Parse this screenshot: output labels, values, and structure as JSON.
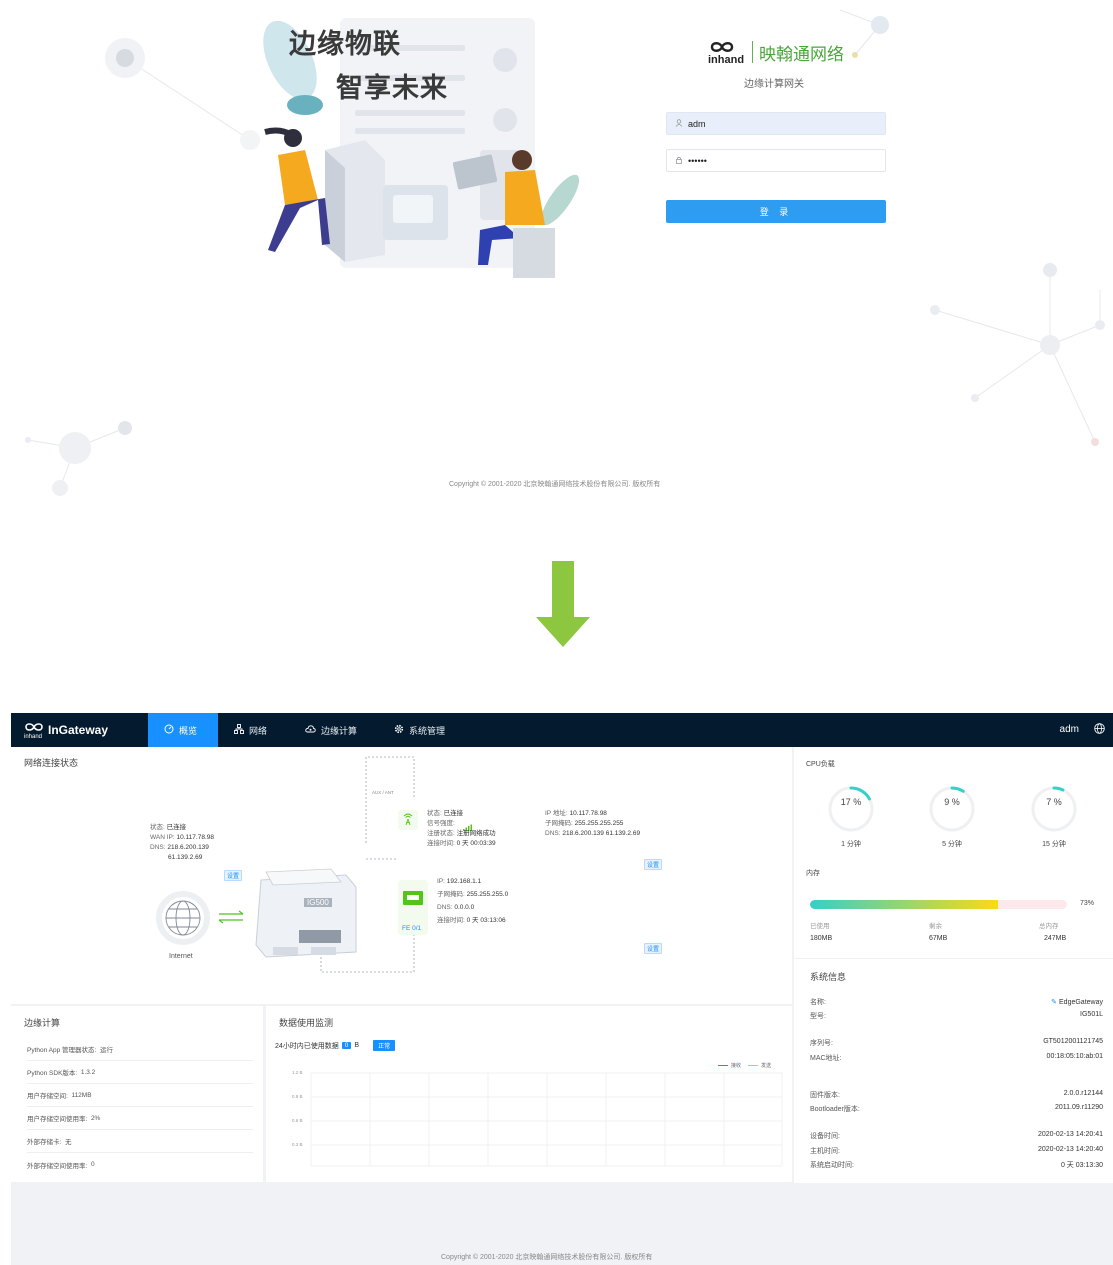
{
  "login": {
    "slogan_line1": "边缘物联",
    "slogan_line2": "智享未来",
    "brand_logo_text": "inhand",
    "brand_name": "映翰通网络",
    "subtitle": "边缘计算网关",
    "username_value": "adm",
    "password_value": "••••••",
    "login_button": "登 录",
    "copyright": "Copyright © 2001-2020 北京映翰通网络技术股份有限公司. 版权所有"
  },
  "arrow": {
    "color": "#8dc63f"
  },
  "nav": {
    "logo_small": "inhand",
    "logo_text": "InGateway",
    "items": [
      {
        "label": "概览",
        "icon": "dashboard-icon",
        "active": true
      },
      {
        "label": "网络",
        "icon": "network-icon",
        "active": false
      },
      {
        "label": "边缘计算",
        "icon": "cloud-icon",
        "active": false
      },
      {
        "label": "系统管理",
        "icon": "gear-icon",
        "active": false
      }
    ],
    "user": "adm",
    "colors": {
      "bar": "#041a2e",
      "active": "#1890ff"
    }
  },
  "network": {
    "title": "网络连接状态",
    "wan": {
      "status_label": "状态:",
      "status": "已连接",
      "ip_label": "WAN IP:",
      "ip": "10.117.78.98",
      "dns_label": "DNS:",
      "dns1": "218.6.200.139",
      "dns2": "61.139.2.69",
      "set": "设置"
    },
    "internet_label": "Internet",
    "device_label": "IG500",
    "aux_label": "AUX / ANT",
    "cellular": {
      "status_label": "状态:",
      "status": "已连接",
      "signal_label": "信号强度:",
      "reg_label": "注册状态:",
      "reg": "注册网络成功",
      "time_label": "连接时间:",
      "time": "0 天 00:03:39",
      "ip_label": "IP 地址:",
      "ip": "10.117.78.98",
      "mask_label": "子网掩码:",
      "mask": "255.255.255.255",
      "dns_label": "DNS:",
      "dns": "218.6.200.139 61.139.2.69",
      "set": "设置"
    },
    "lan": {
      "port": "FE 0/1",
      "ip_label": "IP:",
      "ip": "192.168.1.1",
      "mask_label": "子网掩码:",
      "mask": "255.255.255.0",
      "dns_label": "DNS:",
      "dns": "0.0.0.0",
      "time_label": "连接时间:",
      "time": "0 天 03:13:06",
      "set": "设置"
    }
  },
  "edge": {
    "title": "边缘计算",
    "rows": [
      {
        "label": "Python App 管理器状态:",
        "value": "运行"
      },
      {
        "label": "Python SDK版本:",
        "value": "1.3.2"
      },
      {
        "label": "用户存储空间:",
        "value": "112MB"
      },
      {
        "label": "用户存储空间使用率:",
        "value": "2%"
      },
      {
        "label": "外部存储卡:",
        "value": "无"
      },
      {
        "label": "外部存储空间使用率:",
        "value": "0"
      }
    ]
  },
  "usage": {
    "title": "数据使用监测",
    "line_label": "24小时内已使用数据",
    "value": "0",
    "unit": "B",
    "status": "正常",
    "legend_rx": "接收",
    "legend_tx": "发送",
    "y_ticks": [
      "1.2 B",
      "0.9 B",
      "0.6 B",
      "0.3 B"
    ]
  },
  "cpu": {
    "title": "CPU负载",
    "gauges": [
      {
        "value": 17,
        "text": "17 %",
        "label": "1 分钟"
      },
      {
        "value": 9,
        "text": "9 %",
        "label": "5 分钟"
      },
      {
        "value": 7,
        "text": "7 %",
        "label": "15 分钟"
      }
    ]
  },
  "memory": {
    "title": "内存",
    "percent": 73,
    "percent_text": "73%",
    "used_label": "已使用",
    "used": "180MB",
    "free_label": "剩余",
    "free": "67MB",
    "total_label": "总内存",
    "total": "247MB"
  },
  "system": {
    "title": "系统信息",
    "name_label": "名称:",
    "name": "EdgeGateway",
    "model_label": "型号:",
    "model": "IG501L",
    "serial_label": "序列号:",
    "serial": "GT5012001121745",
    "mac_label": "MAC地址:",
    "mac": "00:18:05:10:ab:01",
    "fw_label": "固件版本:",
    "fw": "2.0.0.r12144",
    "boot_label": "Bootloader版本:",
    "boot": "2011.09.r11290",
    "dev_time_label": "设备时间:",
    "dev_time": "2020-02-13 14:20:41",
    "host_time_label": "主机时间:",
    "host_time": "2020-02-13 14:20:40",
    "uptime_label": "系统启动时间:",
    "uptime": "0 天 03:13:30"
  },
  "footer": {
    "copyright": "Copyright © 2001-2020 北京映翰通网络技术股份有限公司. 版权所有"
  }
}
